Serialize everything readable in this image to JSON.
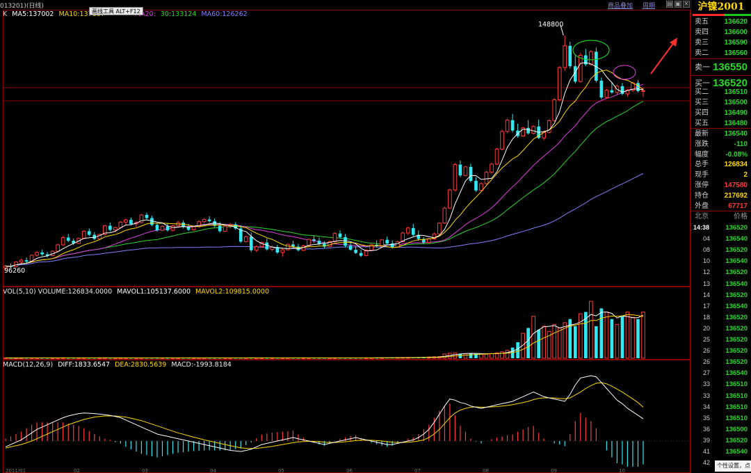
{
  "header": {
    "symbol_label": "013201)(日线)",
    "tool_menu": "画线工具  ALT+F12",
    "goods_link": "商品叠加",
    "period_link": "周期",
    "window_buttons": [
      "▤",
      "▣",
      "✕"
    ]
  },
  "colors": {
    "up": "#ff3b3b",
    "down": "#33e8f0",
    "ma5": "#ffffff",
    "ma10": "#ffd800",
    "ma20": "#e040e0",
    "ma30": "#2ed42e",
    "ma60": "#8080ff",
    "border": "#8b0000",
    "diff": "#ffffff",
    "dea": "#ffd800"
  },
  "main_pane": {
    "k_label": "K",
    "ma_legend": [
      {
        "key": "ma5",
        "text": "MA5:137002"
      },
      {
        "key": "ma10",
        "text": "MA10:137187"
      },
      {
        "key": "ma20",
        "text": "MA20:"
      },
      {
        "key": "ma30",
        "text": "30:133124"
      },
      {
        "key": "ma60",
        "text": "MA60:126262"
      }
    ],
    "high_label": "148800",
    "low_label": "96260"
  },
  "volume_pane": {
    "legend": [
      {
        "key": "white",
        "text": "VOL(5,10) VOLUME:126834.0000"
      },
      {
        "key": "ma5",
        "text": "MAVOL1:105137.6000"
      },
      {
        "key": "ma10",
        "text": "MAVOL2:109815.0000"
      }
    ]
  },
  "macd_pane": {
    "legend": [
      {
        "key": "white",
        "text": "MACD(12,26,9)"
      },
      {
        "key": "diff",
        "text": "DIFF:1833.6547"
      },
      {
        "key": "dea",
        "text": "DEA:2830.5639"
      },
      {
        "key": "white",
        "text": "MACD:-1993.8184"
      }
    ]
  },
  "chart_data": {
    "type": "candlestick",
    "ylim": [
      94000,
      152000
    ],
    "candles": [
      [
        97500,
        98200,
        97000,
        97900
      ],
      [
        97900,
        98500,
        97500,
        97800
      ],
      [
        97800,
        99000,
        97600,
        98800
      ],
      [
        98800,
        99500,
        98400,
        99200
      ],
      [
        99200,
        99800,
        98600,
        98900
      ],
      [
        98900,
        100500,
        98800,
        100300
      ],
      [
        100300,
        101200,
        100000,
        100900
      ],
      [
        100900,
        101500,
        100200,
        100500
      ],
      [
        100500,
        101000,
        99800,
        100200
      ],
      [
        100200,
        101400,
        100100,
        101200
      ],
      [
        101200,
        102800,
        101000,
        102600
      ],
      [
        102600,
        104500,
        102400,
        104200
      ],
      [
        104200,
        105000,
        103200,
        103500
      ],
      [
        103500,
        104000,
        102500,
        102900
      ],
      [
        102900,
        104200,
        102800,
        104000
      ],
      [
        104000,
        105800,
        103800,
        105600
      ],
      [
        105600,
        106200,
        104500,
        104800
      ],
      [
        104800,
        105400,
        103600,
        103900
      ],
      [
        103900,
        105100,
        103800,
        104900
      ],
      [
        104900,
        107000,
        104700,
        106800
      ],
      [
        106800,
        107500,
        105500,
        105900
      ],
      [
        105900,
        106600,
        105400,
        106400
      ],
      [
        106400,
        107900,
        106200,
        107600
      ],
      [
        107600,
        108400,
        107000,
        108100
      ],
      [
        108100,
        108600,
        106900,
        107200
      ],
      [
        107200,
        107800,
        106500,
        107500
      ],
      [
        107500,
        109400,
        107300,
        109200
      ],
      [
        109200,
        109700,
        108200,
        108500
      ],
      [
        108500,
        109000,
        106700,
        107000
      ],
      [
        107000,
        107400,
        105500,
        105800
      ],
      [
        105800,
        106900,
        105600,
        106700
      ],
      [
        106700,
        107300,
        105500,
        105800
      ],
      [
        105800,
        107000,
        105600,
        106800
      ],
      [
        106800,
        107900,
        106500,
        107500
      ],
      [
        107500,
        108000,
        106200,
        106500
      ],
      [
        106500,
        107200,
        105600,
        105900
      ],
      [
        105900,
        106800,
        105700,
        106600
      ],
      [
        106600,
        108000,
        106400,
        107700
      ],
      [
        107700,
        108500,
        107300,
        108200
      ],
      [
        108200,
        108900,
        107500,
        107800
      ],
      [
        107800,
        108400,
        106500,
        106800
      ],
      [
        106800,
        107600,
        105300,
        105600
      ],
      [
        105600,
        107000,
        105400,
        106700
      ],
      [
        106700,
        107400,
        106200,
        107100
      ],
      [
        107100,
        107600,
        105900,
        106200
      ],
      [
        106200,
        106900,
        103000,
        103300
      ],
      [
        103300,
        104600,
        103100,
        104400
      ],
      [
        104400,
        105300,
        101000,
        101400
      ],
      [
        101400,
        102500,
        101000,
        102200
      ],
      [
        102200,
        103300,
        102000,
        103100
      ],
      [
        103100,
        104000,
        101300,
        101600
      ],
      [
        101600,
        102500,
        101200,
        102100
      ],
      [
        102100,
        102600,
        100600,
        100900
      ],
      [
        100900,
        101800,
        100000,
        101500
      ],
      [
        101500,
        102900,
        101300,
        102700
      ],
      [
        102700,
        103500,
        101900,
        102200
      ],
      [
        102200,
        102800,
        101100,
        101400
      ],
      [
        101400,
        102600,
        101200,
        102400
      ],
      [
        102400,
        104000,
        102200,
        103800
      ],
      [
        103800,
        104600,
        103100,
        103500
      ],
      [
        103500,
        104200,
        102500,
        102800
      ],
      [
        102800,
        103400,
        101900,
        102200
      ],
      [
        102200,
        103500,
        102100,
        103300
      ],
      [
        103300,
        105400,
        103100,
        105100
      ],
      [
        105100,
        105800,
        104000,
        104300
      ],
      [
        104300,
        105000,
        102000,
        102400
      ],
      [
        102400,
        103100,
        101300,
        101500
      ],
      [
        101500,
        102300,
        100600,
        100800
      ],
      [
        100800,
        101500,
        99900,
        100200
      ],
      [
        100200,
        101600,
        100100,
        101400
      ],
      [
        101400,
        102800,
        101200,
        102600
      ],
      [
        102600,
        103600,
        102000,
        102300
      ],
      [
        102300,
        103900,
        102100,
        103700
      ],
      [
        103700,
        104400,
        102600,
        102900
      ],
      [
        102900,
        103600,
        101800,
        102100
      ],
      [
        102100,
        103500,
        102000,
        103300
      ],
      [
        103300,
        105500,
        103100,
        105200
      ],
      [
        105200,
        106600,
        104800,
        106300
      ],
      [
        106300,
        107200,
        104500,
        104800
      ],
      [
        104800,
        105800,
        103500,
        103900
      ],
      [
        103900,
        104300,
        102800,
        103100
      ],
      [
        103100,
        104100,
        102900,
        103900
      ],
      [
        103900,
        105300,
        103700,
        105000
      ],
      [
        105000,
        107600,
        104800,
        107400
      ],
      [
        107400,
        111000,
        107200,
        110700
      ],
      [
        110700,
        115000,
        110500,
        114700
      ],
      [
        114700,
        120600,
        114400,
        120300
      ],
      [
        120300,
        121200,
        117500,
        117900
      ],
      [
        117900,
        120000,
        117700,
        119800
      ],
      [
        119800,
        120500,
        116400,
        116700
      ],
      [
        116700,
        117500,
        114300,
        114600
      ],
      [
        114600,
        116400,
        114400,
        116100
      ],
      [
        116100,
        118900,
        115900,
        118600
      ],
      [
        118600,
        120700,
        118300,
        120400
      ],
      [
        120400,
        124000,
        120200,
        123700
      ],
      [
        123700,
        128000,
        123400,
        127600
      ],
      [
        127600,
        130500,
        127200,
        130100
      ],
      [
        130100,
        131500,
        127400,
        127800
      ],
      [
        127800,
        129300,
        126200,
        126600
      ],
      [
        126600,
        128600,
        126400,
        128400
      ],
      [
        128400,
        130100,
        126900,
        127200
      ],
      [
        127200,
        129000,
        126900,
        128700
      ],
      [
        128700,
        130200,
        125900,
        126200
      ],
      [
        126200,
        127800,
        125700,
        127400
      ],
      [
        127400,
        130300,
        127200,
        130000
      ],
      [
        130000,
        135000,
        129800,
        134600
      ],
      [
        134600,
        142000,
        134300,
        141700
      ],
      [
        141700,
        148800,
        141000,
        146500
      ],
      [
        146500,
        147400,
        141500,
        142000
      ],
      [
        142000,
        144500,
        138200,
        138600
      ],
      [
        138600,
        145000,
        138400,
        144400
      ],
      [
        144400,
        145800,
        142000,
        142400
      ],
      [
        142400,
        145600,
        142100,
        145200
      ],
      [
        145200,
        146100,
        138400,
        138800
      ],
      [
        138800,
        139500,
        134700,
        135100
      ],
      [
        135100,
        137000,
        134800,
        136700
      ],
      [
        136700,
        138500,
        135900,
        136200
      ],
      [
        136200,
        138000,
        135800,
        137600
      ],
      [
        137600,
        138300,
        135600,
        135900
      ],
      [
        135900,
        137000,
        135300,
        136700
      ],
      [
        136700,
        138600,
        136300,
        138300
      ],
      [
        138300,
        138900,
        136200,
        136500
      ],
      [
        136500,
        137300,
        135200,
        136600
      ]
    ],
    "volume": [
      900,
      800,
      850,
      900,
      1000,
      950,
      1100,
      1000,
      900,
      1000,
      1100,
      1200,
      1000,
      950,
      1000,
      1100,
      1050,
      1000,
      1100,
      1200,
      1000,
      950,
      1050,
      1100,
      1000,
      950,
      1100,
      1050,
      1000,
      950,
      900,
      950,
      1000,
      1050,
      1000,
      950,
      1000,
      1100,
      1050,
      1000,
      950,
      1000,
      1050,
      1100,
      1000,
      1050,
      1100,
      1150,
      1000,
      950,
      1000,
      1050,
      1100,
      1000,
      950,
      1000,
      1050,
      1100,
      1050,
      1000,
      950,
      1000,
      1100,
      1150,
      1050,
      1000,
      950,
      1000,
      1050,
      1100,
      1150,
      1200,
      1300,
      1400,
      1500,
      1800,
      2000,
      2200,
      2400,
      2600,
      3000,
      3500,
      4000,
      4500,
      12000,
      14000,
      15000,
      13000,
      12000,
      14000,
      13000,
      12500,
      11000,
      13000,
      15000,
      18000,
      22000,
      30000,
      45000,
      70000,
      85000,
      118000,
      80000,
      90000,
      75000,
      95000,
      85000,
      100000,
      110000,
      90000,
      125000,
      130000,
      160000,
      90000,
      140000,
      130000,
      110000,
      95000,
      120000,
      130000,
      115000,
      110000,
      130000
    ],
    "volume_ylim": [
      0,
      170000
    ],
    "macd_diff": [
      -500,
      -300,
      -100,
      100,
      400,
      700,
      1000,
      1200,
      1400,
      1600,
      1800,
      2000,
      2150,
      2250,
      2350,
      2400,
      2380,
      2350,
      2300,
      2250,
      2200,
      2100,
      2000,
      1800,
      1600,
      1400,
      1200,
      1000,
      800,
      600,
      500,
      400,
      300,
      200,
      100,
      0,
      -100,
      -200,
      -300,
      -400,
      -500,
      -600,
      -700,
      -800,
      -850,
      -900,
      -800,
      -700,
      -500,
      -300,
      -200,
      -100,
      0,
      100,
      200,
      300,
      200,
      100,
      0,
      -100,
      -200,
      -300,
      -200,
      -100,
      0,
      100,
      200,
      300,
      200,
      100,
      0,
      -100,
      -200,
      -300,
      -300,
      -200,
      -100,
      0,
      100,
      300,
      600,
      1000,
      1600,
      2300,
      3000,
      3600,
      3500,
      3300,
      3200,
      3000,
      2900,
      2800,
      2900,
      3000,
      3100,
      3200,
      3300,
      3400,
      3600,
      3800,
      4000,
      4200,
      4000,
      3800,
      3700,
      3600,
      3500,
      3400,
      4000,
      4800,
      5400,
      5500,
      5600,
      5500,
      5000,
      4500,
      4000,
      3500,
      3200,
      2800,
      2500,
      2200,
      1900
    ],
    "macd_dea": [
      -600,
      -500,
      -400,
      -300,
      -150,
      0,
      200,
      400,
      600,
      800,
      1000,
      1200,
      1400,
      1550,
      1700,
      1850,
      1950,
      2050,
      2100,
      2150,
      2150,
      2150,
      2100,
      2050,
      1950,
      1850,
      1750,
      1600,
      1450,
      1300,
      1150,
      1000,
      850,
      700,
      580,
      450,
      330,
      220,
      100,
      0,
      -100,
      -200,
      -300,
      -400,
      -500,
      -580,
      -620,
      -640,
      -620,
      -580,
      -520,
      -460,
      -380,
      -300,
      -220,
      -140,
      -80,
      -40,
      -20,
      -20,
      -50,
      -100,
      -120,
      -120,
      -100,
      -60,
      -10,
      40,
      70,
      80,
      70,
      40,
      0,
      -50,
      -100,
      -120,
      -120,
      -100,
      -60,
      0,
      100,
      300,
      600,
      1000,
      1500,
      2000,
      2400,
      2650,
      2800,
      2900,
      2920,
      2900,
      2900,
      2920,
      2950,
      3000,
      3050,
      3120,
      3200,
      3300,
      3400,
      3550,
      3650,
      3700,
      3700,
      3700,
      3650,
      3620,
      3700,
      3950,
      4200,
      4500,
      4750,
      4950,
      5000,
      4900,
      4700,
      4450,
      4200,
      3900,
      3600,
      3300,
      2900
    ],
    "macd_ylim": [
      -2500,
      6200
    ],
    "x_ticks": [
      "2011/01",
      "02",
      "03",
      "04",
      "05",
      "06",
      "07",
      "08",
      "09",
      "10"
    ]
  },
  "panel": {
    "title": "沪镍2001",
    "asks": [
      {
        "label": "卖五",
        "value": "136620"
      },
      {
        "label": "卖四",
        "value": "136600"
      },
      {
        "label": "卖三",
        "value": "136590"
      },
      {
        "label": "卖二",
        "value": "136560"
      }
    ],
    "ask1": {
      "label": "卖一",
      "value": "136550"
    },
    "bid1": {
      "label": "买一",
      "value": "136520"
    },
    "bids": [
      {
        "label": "买二",
        "value": "136510"
      },
      {
        "label": "买三",
        "value": "136500"
      },
      {
        "label": "买四",
        "value": "136490"
      },
      {
        "label": "买五",
        "value": "136480"
      }
    ],
    "stats": [
      {
        "label": "最新",
        "value": "136540",
        "tone": "down"
      },
      {
        "label": "涨跌",
        "value": "-110",
        "tone": "down"
      },
      {
        "label": "幅度",
        "value": "-0.08%",
        "tone": "down"
      },
      {
        "label": "总手",
        "value": "126834",
        "tone": "neutral"
      },
      {
        "label": "现手",
        "value": "2",
        "tone": "neutral"
      },
      {
        "label": "涨停",
        "value": "147580",
        "tone": "up"
      },
      {
        "label": "持仓",
        "value": "217692",
        "tone": "neutral"
      },
      {
        "label": "外盘",
        "value": "67717",
        "tone": "up"
      }
    ],
    "tick_header": {
      "left": "北京",
      "right": "价格"
    },
    "ticks": [
      {
        "time": "14:38",
        "price": "136520",
        "tone": "down"
      },
      {
        "time": "04",
        "price": "136540",
        "tone": "down"
      },
      {
        "time": "08",
        "price": "136520",
        "tone": "down"
      },
      {
        "time": "10",
        "price": "136540",
        "tone": "down"
      },
      {
        "time": "12",
        "price": "136520",
        "tone": "down"
      },
      {
        "time": "13",
        "price": "136540",
        "tone": "down"
      },
      {
        "time": "14",
        "price": "136520",
        "tone": "down"
      },
      {
        "time": "17",
        "price": "136540",
        "tone": "down"
      },
      {
        "time": "18",
        "price": "136520",
        "tone": "down"
      },
      {
        "time": "20",
        "price": "136520",
        "tone": "down"
      },
      {
        "time": "25",
        "price": "136520",
        "tone": "down"
      },
      {
        "time": "26",
        "price": "136520",
        "tone": "down"
      },
      {
        "time": "26",
        "price": "136520",
        "tone": "down"
      },
      {
        "time": "27",
        "price": "136540",
        "tone": "down"
      },
      {
        "time": "33",
        "price": "136510",
        "tone": "down"
      },
      {
        "time": "33",
        "price": "136510",
        "tone": "down"
      },
      {
        "time": "34",
        "price": "136510",
        "tone": "down"
      },
      {
        "time": "35",
        "price": "136510",
        "tone": "down"
      },
      {
        "time": "36",
        "price": "136500",
        "tone": "down"
      },
      {
        "time": "39",
        "price": "136520",
        "tone": "down"
      },
      {
        "time": "41",
        "price": "136540",
        "tone": "down"
      },
      {
        "time": "42",
        "price": "",
        "tone": "down"
      }
    ],
    "tooltip": "个性设置，点"
  }
}
